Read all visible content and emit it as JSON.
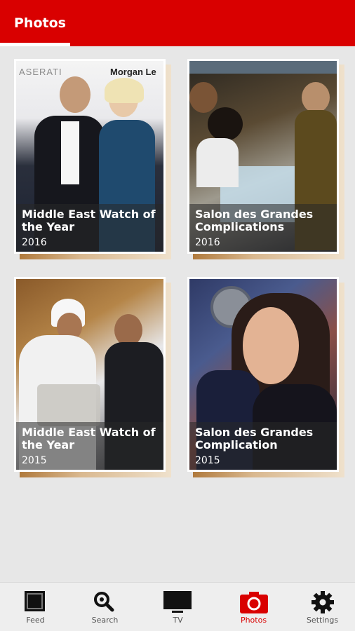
{
  "header": {
    "title": "Photos"
  },
  "photo_text": {
    "p1_brand_left": "ASERATI",
    "p1_brand_right": "Morgan Le"
  },
  "cards": [
    {
      "title": "Middle East Watch of the Year",
      "year": "2016"
    },
    {
      "title": "Salon des Grandes Complications",
      "year": "2016"
    },
    {
      "title": "Middle East Watch of the Year",
      "year": "2015"
    },
    {
      "title": "Salon des Grandes Complication",
      "year": "2015"
    }
  ],
  "nav": {
    "items": [
      {
        "label": "Feed",
        "icon": "feed-icon"
      },
      {
        "label": "Search",
        "icon": "search-icon"
      },
      {
        "label": "TV",
        "icon": "tv-icon"
      },
      {
        "label": "Photos",
        "icon": "camera-icon"
      },
      {
        "label": "Settings",
        "icon": "gear-icon"
      }
    ],
    "active": "Photos"
  },
  "colors": {
    "accent": "#d90000",
    "background": "#e7e7e7",
    "nav_background": "#eeeeee",
    "inactive_text": "#555555"
  }
}
